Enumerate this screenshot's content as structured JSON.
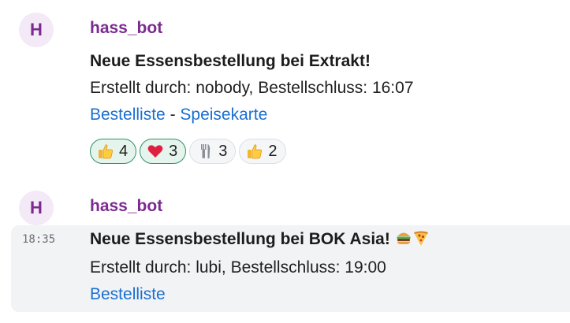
{
  "messages": [
    {
      "avatar_letter": "H",
      "sender": "hass_bot",
      "title": "Neue Essensbestellung bei Extrakt!",
      "detail": "Erstellt durch: nobody, Bestellschluss: 16:07",
      "links": [
        "Bestelliste",
        "Speisekarte"
      ],
      "link_separator": "-",
      "reactions": [
        {
          "icon": "thumbs-up-icon",
          "count": "4",
          "active": true
        },
        {
          "icon": "heart-icon",
          "count": "3",
          "active": true
        },
        {
          "icon": "fork-knife-icon",
          "count": "3",
          "active": false
        },
        {
          "icon": "thumbs-up-icon",
          "count": "2",
          "active": false
        }
      ]
    },
    {
      "avatar_letter": "H",
      "sender": "hass_bot",
      "timestamp": "18:35",
      "title": "Neue Essensbestellung bei BOK Asia!",
      "title_emojis": [
        "burger-icon",
        "pizza-icon"
      ],
      "detail": "Erstellt durch: lubi, Bestellschluss: 19:00",
      "links": [
        "Bestelliste"
      ]
    }
  ],
  "colors": {
    "sender": "#7b2a8f",
    "link": "#1a6fd1",
    "active_reaction_border": "#2f8f68"
  }
}
